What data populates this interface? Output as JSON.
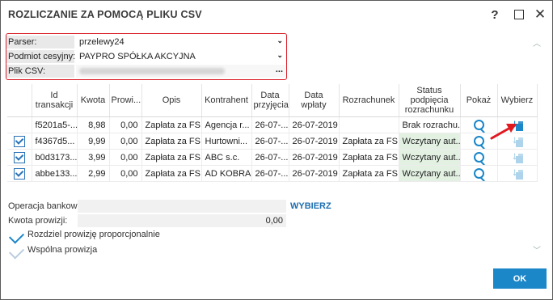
{
  "window": {
    "title": "ROZLICZANIE ZA POMOCĄ PLIKU CSV",
    "help_glyph": "?",
    "maximize_glyph": "",
    "close_glyph": "✕"
  },
  "params": {
    "parser_label": "Parser:",
    "parser_value": "przelewy24",
    "podmiot_label": "Podmiot cesyjny:",
    "podmiot_value": "PAYPRO SPÓŁKA AKCYJNA",
    "plik_label": "Plik CSV:",
    "plik_button": "..."
  },
  "table": {
    "headers": [
      "",
      "Id transakcji",
      "Kwota",
      "Prowi...",
      "Opis",
      "Kontrahent",
      "Data przyjęcia",
      "Data wpłaty",
      "Rozrachunek",
      "Status podpięcia rozrachunku",
      "Pokaż",
      "Wybierz"
    ],
    "rows": [
      {
        "checked": false,
        "id": "f5201a5-...",
        "kwota": "8,98",
        "prowizja": "0,00",
        "opis": "Zapłata za FS...",
        "kontrahent": "Agencja r...",
        "data_przyjecia": "26-07-...",
        "data_wplaty": "26-07-2019",
        "rozrachunek": "",
        "status": "Brak rozrachu..."
      },
      {
        "checked": true,
        "id": "f4367d5...",
        "kwota": "9,99",
        "prowizja": "0,00",
        "opis": "Zapłata za FS...",
        "kontrahent": "Hurtowni...",
        "data_przyjecia": "26-07-...",
        "data_wplaty": "26-07-2019",
        "rozrachunek": "Zapłata za FS...",
        "status": "Wczytany aut..."
      },
      {
        "checked": true,
        "id": "b0d3173...",
        "kwota": "3,99",
        "prowizja": "0,00",
        "opis": "Zapłata za FS...",
        "kontrahent": "ABC s.c.",
        "data_przyjecia": "26-07-...",
        "data_wplaty": "26-07-2019",
        "rozrachunek": "Zapłata za FS...",
        "status": "Wczytany aut..."
      },
      {
        "checked": true,
        "id": "abbe133...",
        "kwota": "2,99",
        "prowizja": "0,00",
        "opis": "Zapłata za FS...",
        "kontrahent": "AD KOBRA",
        "data_przyjecia": "26-07-...",
        "data_wplaty": "26-07-2019",
        "rozrachunek": "Zapłata za FS...",
        "status": "Wczytany aut..."
      }
    ]
  },
  "bottom": {
    "operacja_label": "Operacja bankowa:",
    "wybierz_link": "WYBIERZ",
    "kwota_label": "Kwota prowizji:",
    "kwota_value": "0,00",
    "rozdziel_label": "Rozdziel prowizję proporcjonalnie",
    "wspolna_label": "Wspólna prowizja",
    "ok_label": "OK"
  },
  "colors": {
    "accent": "#1b86c8",
    "highlight": "#d9202a",
    "status_ok_bg": "#e3f1e3"
  }
}
